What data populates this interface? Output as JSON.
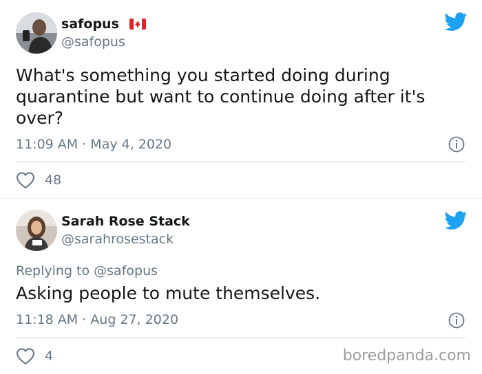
{
  "tweets": [
    {
      "display_name": "safopus",
      "flag": "🇨🇦",
      "handle": "@safopus",
      "text": "What's something you started doing during quarantine but want to continue doing after it's over?",
      "timestamp": "11:09 AM · May 4, 2020",
      "likes": "48",
      "avatar_icon": "avatar-photo-man"
    },
    {
      "display_name": "Sarah Rose Stack",
      "handle": "@sarahrosestack",
      "replying_to": "Replying to @safopus",
      "text": "Asking people to mute themselves.",
      "timestamp": "11:18 AM · Aug 27, 2020",
      "likes": "4",
      "avatar_icon": "avatar-photo-woman"
    }
  ],
  "watermark": "boredpanda.com",
  "colors": {
    "twitter_blue": "#1da1f2",
    "secondary_text": "#657786",
    "primary_text": "#14171a",
    "divider": "#e6ecf0"
  }
}
